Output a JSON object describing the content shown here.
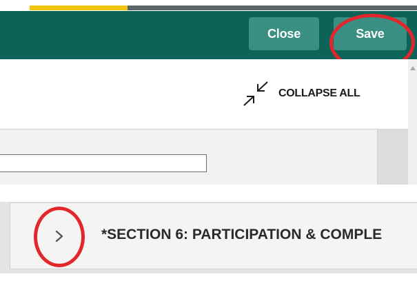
{
  "toolbar": {
    "close_label": "Close",
    "save_label": "Save",
    "background_color": "#0b6457",
    "button_color": "#3b8f82"
  },
  "progress": {
    "accent_color": "#f1c40f"
  },
  "content": {
    "collapse_all_label": "COLLAPSE ALL",
    "collapse_icon": "collapse-arrows-icon",
    "field_value": ""
  },
  "section": {
    "title": "*SECTION 6: PARTICIPATION & COMPLE",
    "toggle_icon": "chevron-right-icon"
  },
  "annotations": {
    "highlight_color": "#e3262c"
  }
}
